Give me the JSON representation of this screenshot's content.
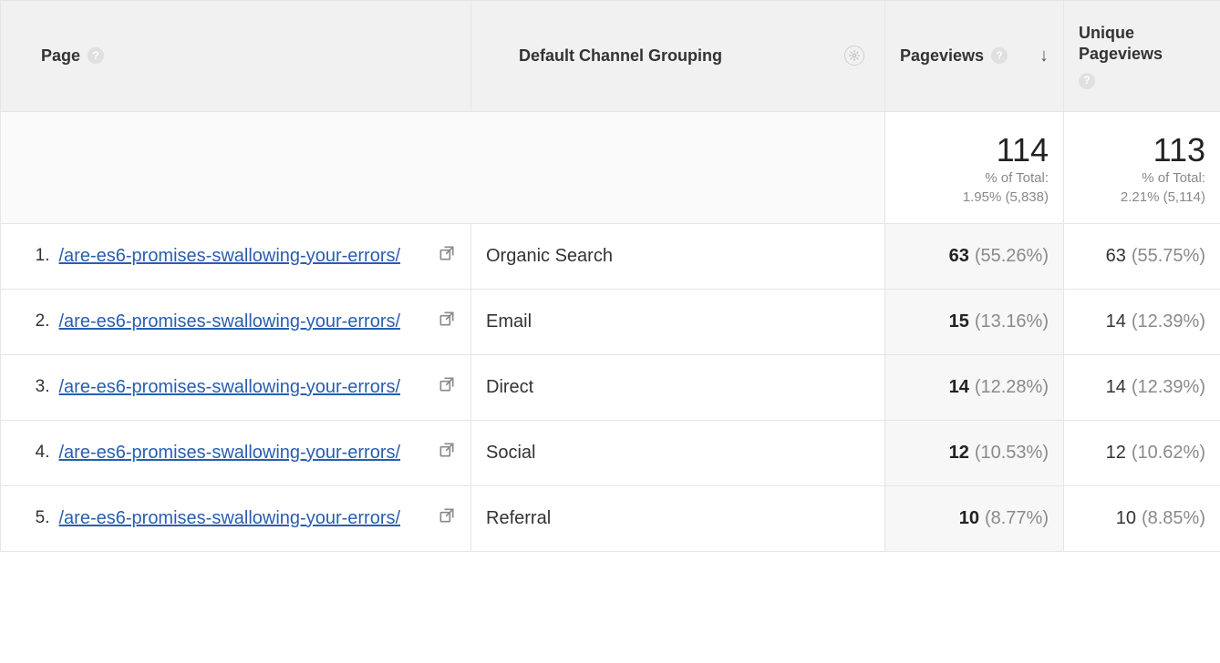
{
  "headers": {
    "page": "Page",
    "channel": "Default Channel Grouping",
    "pageviews": "Pageviews",
    "unique_pageviews": "Unique Pageviews"
  },
  "summary": {
    "pageviews": {
      "total": "114",
      "pct_label": "% of Total:",
      "pct": "1.95% (5,838)"
    },
    "unique_pageviews": {
      "total": "113",
      "pct_label": "% of Total:",
      "pct": "2.21% (5,114)"
    }
  },
  "rows": [
    {
      "idx": "1.",
      "page": "/are-es6-promises-swallowing-your-errors/",
      "channel": "Organic Search",
      "pv": "63",
      "pv_pct": "(55.26%)",
      "upv": "63",
      "upv_pct": "(55.75%)"
    },
    {
      "idx": "2.",
      "page": "/are-es6-promises-swallowing-your-errors/",
      "channel": "Email",
      "pv": "15",
      "pv_pct": "(13.16%)",
      "upv": "14",
      "upv_pct": "(12.39%)"
    },
    {
      "idx": "3.",
      "page": "/are-es6-promises-swallowing-your-errors/",
      "channel": "Direct",
      "pv": "14",
      "pv_pct": "(12.28%)",
      "upv": "14",
      "upv_pct": "(12.39%)"
    },
    {
      "idx": "4.",
      "page": "/are-es6-promises-swallowing-your-errors/",
      "channel": "Social",
      "pv": "12",
      "pv_pct": "(10.53%)",
      "upv": "12",
      "upv_pct": "(10.62%)"
    },
    {
      "idx": "5.",
      "page": "/are-es6-promises-swallowing-your-errors/",
      "channel": "Referral",
      "pv": "10",
      "pv_pct": "(8.77%)",
      "upv": "10",
      "upv_pct": "(8.85%)"
    }
  ]
}
